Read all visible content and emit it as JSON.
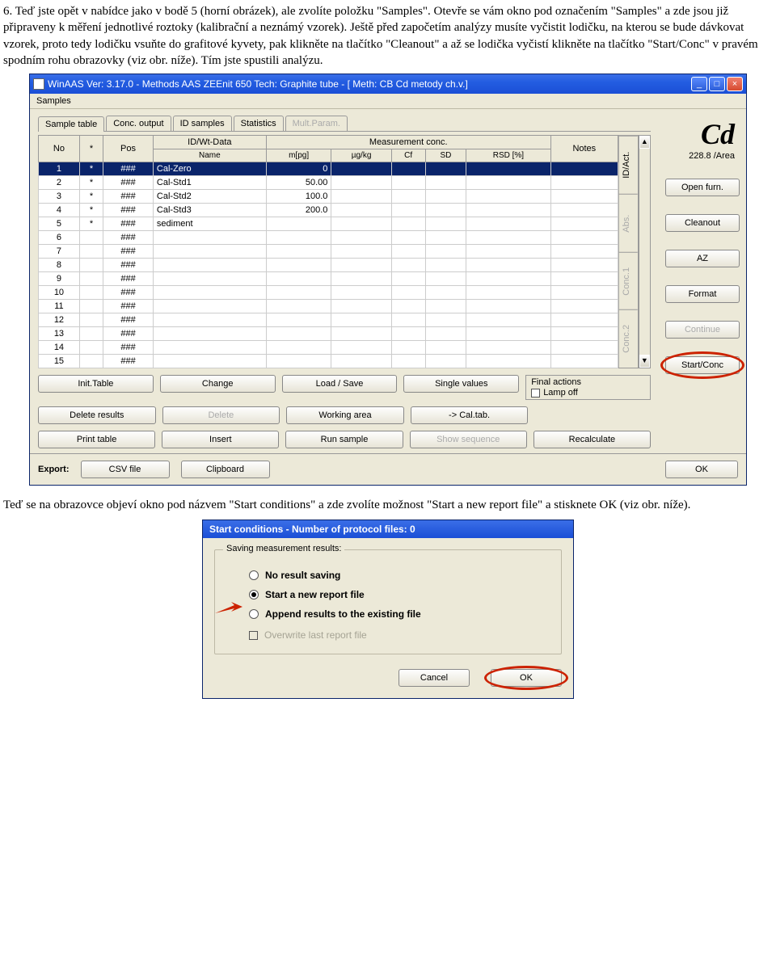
{
  "doc": {
    "p1": "6. Teď jste opět v nabídce jako v bodě 5 (horní obrázek), ale zvolíte položku \"Samples\". Otevře se vám okno pod označením \"Samples\" a zde jsou již připraveny k měření jednotlivé roztoky (kalibrační a neznámý vzorek). Ještě před započetím analýzy musíte vyčistit lodičku, na kterou se bude dávkovat vzorek, proto tedy lodičku vsuňte do grafitové kyvety, pak klikněte na tlačítko \"Cleanout\" a až se lodička vyčistí klikněte na tlačítko \"Start/Conc\" v pravém spodním rohu obrazovky (viz obr. níže). Tím jste spustili analýzu.",
    "p2": "Teď se na obrazovce objeví okno pod názvem \"Start conditions\" a zde zvolíte možnost \"Start a new report file\" a stisknete OK (viz obr. níže)."
  },
  "win": {
    "title": "WinAAS Ver:  3.17.0  -  Methods   AAS ZEEnit 650 Tech: Graphite tube - [ Meth: CB Cd metody ch.v.]",
    "menu": "Samples",
    "tabs": [
      "Sample table",
      "Conc. output",
      "ID samples",
      "Statistics",
      "Mult.Param."
    ],
    "vtabs": [
      "ID/Act.",
      "Abs.",
      "Conc.1",
      "Conc.2"
    ],
    "headers": {
      "No": "No",
      "star": "*",
      "Pos": "Pos",
      "id": "ID/Wt-Data",
      "mc": "Measurement conc.",
      "Name": "Name",
      "m": "m[pg]",
      "ug": "µg/kg",
      "Cf": "Cf",
      "SD": "SD",
      "RSD": "RSD [%]",
      "Notes": "Notes"
    },
    "rows": [
      {
        "no": "1",
        "s": "*",
        "p": "###",
        "name": "Cal-Zero",
        "m": "0"
      },
      {
        "no": "2",
        "s": "*",
        "p": "###",
        "name": "Cal-Std1",
        "m": "50.00"
      },
      {
        "no": "3",
        "s": "*",
        "p": "###",
        "name": "Cal-Std2",
        "m": "100.0"
      },
      {
        "no": "4",
        "s": "*",
        "p": "###",
        "name": "Cal-Std3",
        "m": "200.0"
      },
      {
        "no": "5",
        "s": "*",
        "p": "###",
        "name": "sediment",
        "m": ""
      },
      {
        "no": "6",
        "s": "",
        "p": "###",
        "name": "",
        "m": ""
      },
      {
        "no": "7",
        "s": "",
        "p": "###",
        "name": "",
        "m": ""
      },
      {
        "no": "8",
        "s": "",
        "p": "###",
        "name": "",
        "m": ""
      },
      {
        "no": "9",
        "s": "",
        "p": "###",
        "name": "",
        "m": ""
      },
      {
        "no": "10",
        "s": "",
        "p": "###",
        "name": "",
        "m": ""
      },
      {
        "no": "11",
        "s": "",
        "p": "###",
        "name": "",
        "m": ""
      },
      {
        "no": "12",
        "s": "",
        "p": "###",
        "name": "",
        "m": ""
      },
      {
        "no": "13",
        "s": "",
        "p": "###",
        "name": "",
        "m": ""
      },
      {
        "no": "14",
        "s": "",
        "p": "###",
        "name": "",
        "m": ""
      },
      {
        "no": "15",
        "s": "",
        "p": "###",
        "name": "",
        "m": ""
      }
    ],
    "btns": {
      "init": "Init.Table",
      "change": "Change",
      "load": "Load / Save",
      "single": "Single values",
      "delres": "Delete results",
      "delete": "Delete",
      "work": "Working area",
      "cal": "-> Cal.tab.",
      "print": "Print table",
      "insert": "Insert",
      "run": "Run sample",
      "show": "Show sequence",
      "recalc": "Recalculate",
      "csv": "CSV file",
      "clip": "Clipboard",
      "ok": "OK"
    },
    "final": {
      "title": "Final actions",
      "lamp": "Lamp off"
    },
    "export": "Export:",
    "elem": "Cd",
    "line": "228.8 /Area",
    "rb": {
      "open": "Open furn.",
      "clean": "Cleanout",
      "az": "AZ",
      "fmt": "Format",
      "cont": "Continue",
      "start": "Start/Conc"
    }
  },
  "dlg": {
    "title": "Start conditions - Number of protocol files:   0",
    "legend": "Saving measurement results:",
    "r1": "No result saving",
    "r2": "Start a new report file",
    "r3": "Append results to the existing file",
    "chk": "Overwrite last report file",
    "cancel": "Cancel",
    "ok": "OK"
  }
}
